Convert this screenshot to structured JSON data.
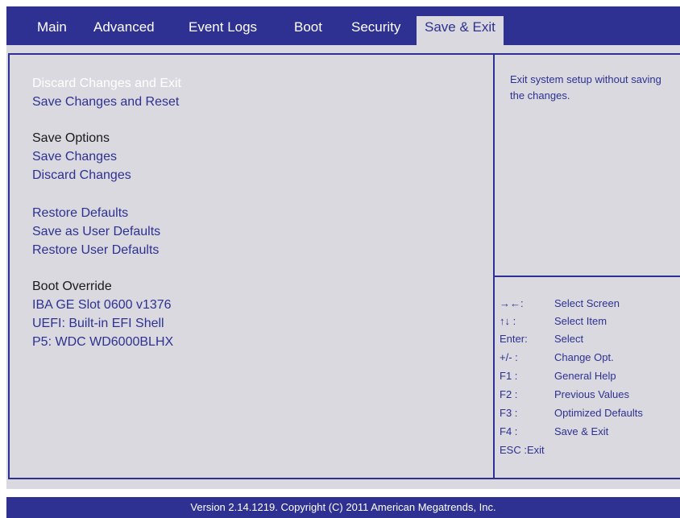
{
  "tabs": [
    {
      "label": "Main"
    },
    {
      "label": "Advanced"
    },
    {
      "label": "Event Logs"
    },
    {
      "label": "Boot"
    },
    {
      "label": "Security"
    },
    {
      "label": "Save & Exit",
      "active": true
    }
  ],
  "menu": {
    "discard_exit": "Discard Changes and Exit",
    "save_reset": "Save Changes and Reset",
    "save_options_header": "Save Options",
    "save_changes": "Save Changes",
    "discard_changes": "Discard Changes",
    "restore_defaults": "Restore Defaults",
    "save_user_defaults": "Save as User Defaults",
    "restore_user_defaults": "Restore User Defaults",
    "boot_override_header": "Boot Override",
    "boot_iba": "IBA GE Slot 0600 v1376",
    "boot_uefi": "UEFI: Built-in EFI Shell",
    "boot_p5": "P5: WDC WD6000BLHX"
  },
  "help": {
    "description": "Exit system setup without saving the changes."
  },
  "keys": [
    {
      "key": "→←:",
      "desc": "Select Screen"
    },
    {
      "key": "↑↓ :",
      "desc": "Select Item"
    },
    {
      "key": "Enter:",
      "desc": "Select"
    },
    {
      "key": "+/- :",
      "desc": "Change Opt."
    },
    {
      "key": "F1 :",
      "desc": "General Help"
    },
    {
      "key": "F2 :",
      "desc": "Previous Values"
    },
    {
      "key": "F3 :",
      "desc": "Optimized Defaults"
    },
    {
      "key": "F4 :",
      "desc": "Save & Exit"
    },
    {
      "key": "ESC :Exit",
      "desc": ""
    }
  ],
  "footer": "Version 2.14.1219. Copyright (C) 2011 American Megatrends, Inc.",
  "colors": {
    "accent": "#2e3192",
    "panel": "#d9d9df",
    "selected_text": "#ffffff"
  }
}
